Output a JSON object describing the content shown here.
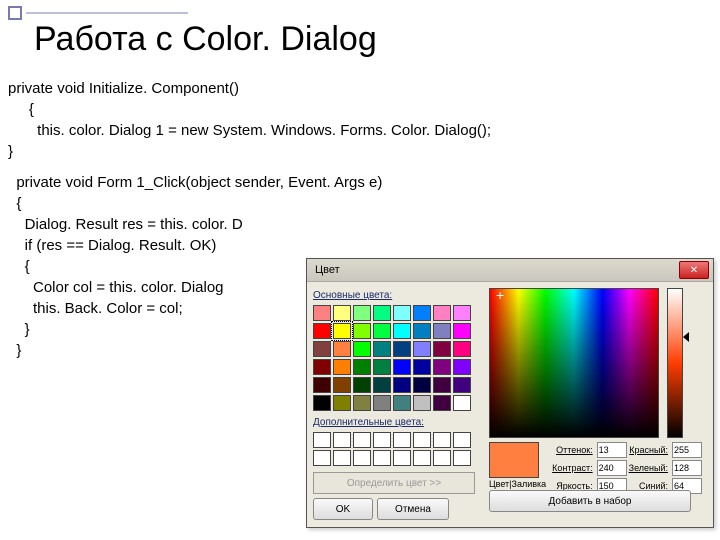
{
  "title": "Работа с Color. Dialog",
  "code": {
    "l1": "private void Initialize. Component()",
    "l2": "     {",
    "l3": "       this. color. Dialog 1 = new System. Windows. Forms. Color. Dialog();",
    "l4": "}",
    "l5": "  private void Form 1_Click(object sender, Event. Args e)",
    "l6": "  {",
    "l7": "    Dialog. Result res = this. color. D",
    "l8": "    if (res == Dialog. Result. OK)",
    "l9": "    {",
    "l10": "      Color col = this. color. Dialog",
    "l11": "      this. Back. Color = col;",
    "l12": "    }",
    "l13": "  }"
  },
  "dialog": {
    "title": "Цвет",
    "basic_label": "Основные цвета:",
    "custom_label": "Дополнительные цвета:",
    "define_btn": "Определить цвет >>",
    "ok": "OK",
    "cancel": "Отмена",
    "add_btn": "Добавить в набор",
    "solid_label": "Цвет|Заливка",
    "fields": {
      "hue_l": "Оттенок:",
      "hue_v": "13",
      "sat_l": "Контраст:",
      "sat_v": "240",
      "lum_l": "Яркость:",
      "lum_v": "150",
      "r_l": "Красный:",
      "r_v": "255",
      "g_l": "Зеленый:",
      "g_v": "128",
      "b_l": "Синий:",
      "b_v": "64"
    },
    "basic_colors": [
      "#ff8080",
      "#ffff80",
      "#80ff80",
      "#00ff80",
      "#80ffff",
      "#0080ff",
      "#ff80c0",
      "#ff80ff",
      "#ff0000",
      "#ffff00",
      "#80ff00",
      "#00ff40",
      "#00ffff",
      "#0080c0",
      "#8080c0",
      "#ff00ff",
      "#804040",
      "#ff8040",
      "#00ff00",
      "#008080",
      "#004080",
      "#8080ff",
      "#800040",
      "#ff0080",
      "#800000",
      "#ff8000",
      "#008000",
      "#008040",
      "#0000ff",
      "#0000a0",
      "#800080",
      "#8000ff",
      "#400000",
      "#804000",
      "#004000",
      "#004040",
      "#000080",
      "#000040",
      "#400040",
      "#400080",
      "#000000",
      "#808000",
      "#808040",
      "#808080",
      "#408080",
      "#c0c0c0",
      "#400040",
      "#ffffff"
    ],
    "selected_index": 9,
    "preview_color": "#ff7f40"
  }
}
